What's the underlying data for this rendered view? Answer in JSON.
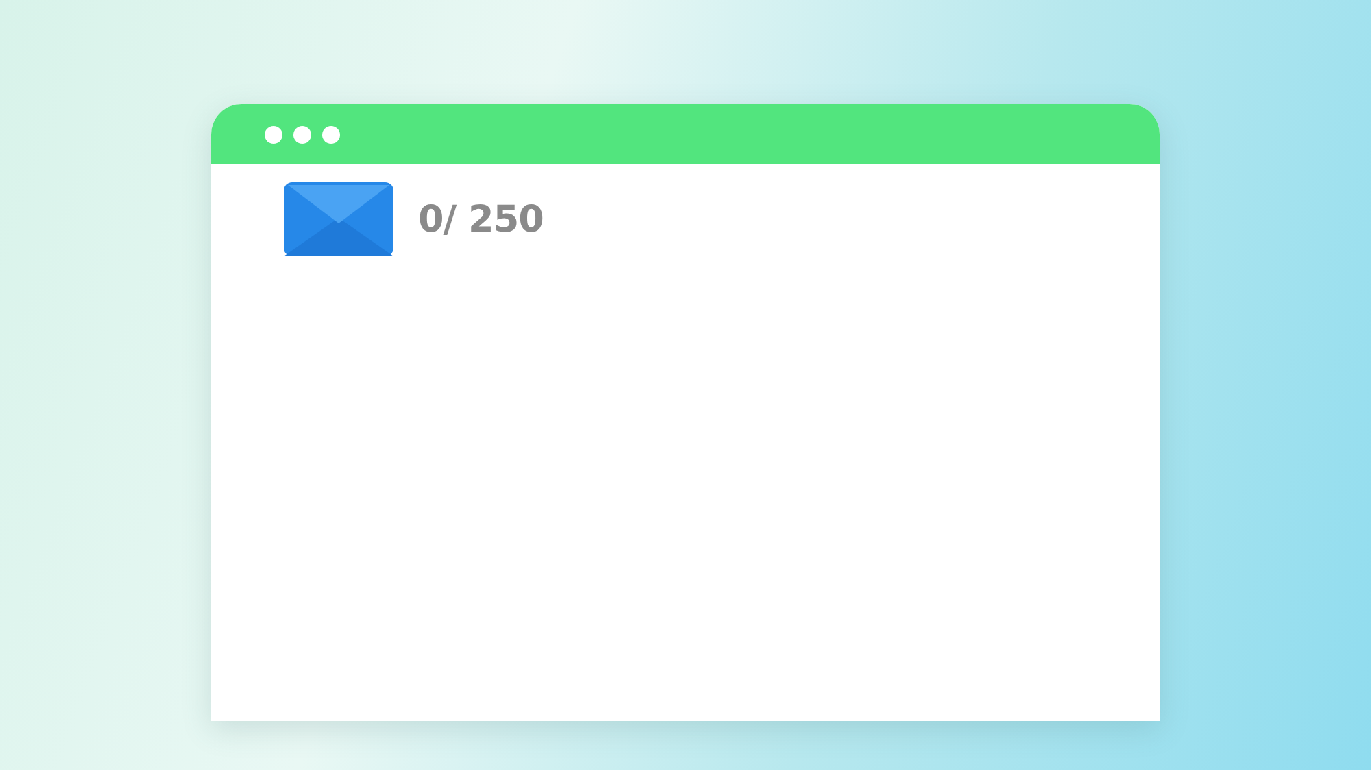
{
  "window": {
    "controls": [
      {
        "kind": "dot"
      },
      {
        "kind": "dot"
      },
      {
        "kind": "dot"
      }
    ]
  },
  "counter": {
    "text": "0/ 250"
  }
}
